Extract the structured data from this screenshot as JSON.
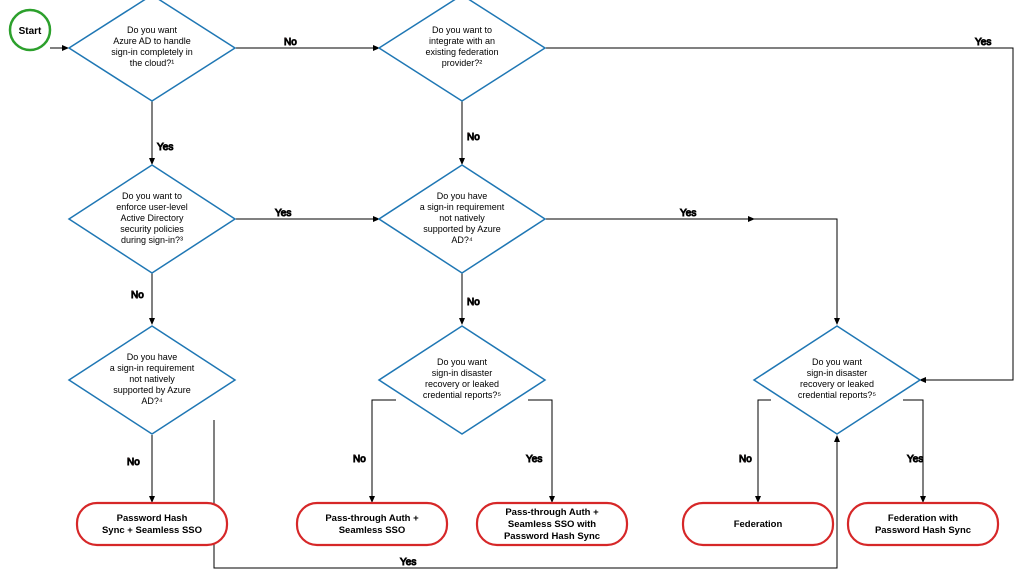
{
  "start": {
    "label": "Start"
  },
  "decisions": {
    "d1": {
      "l1": "Do you want",
      "l2": "Azure AD to handle",
      "l3": "sign-in completely in",
      "l4": "the cloud?¹"
    },
    "d2": {
      "l1": "Do you want to",
      "l2": "integrate with an",
      "l3": "existing federation",
      "l4": "provider?²"
    },
    "d3": {
      "l1": "Do you want to",
      "l2": "enforce user-level",
      "l3": "Active Directory",
      "l4": "security policies",
      "l5": "during sign-in?³"
    },
    "d4": {
      "l1": "Do you have",
      "l2": "a sign-in requirement",
      "l3": "not natively",
      "l4": "supported by Azure",
      "l5": "AD?⁴"
    },
    "d5": {
      "l1": "Do you have",
      "l2": "a sign-in requirement",
      "l3": "not natively",
      "l4": "supported by Azure",
      "l5": "AD?⁴"
    },
    "d6": {
      "l1": "Do you want",
      "l2": "sign-in disaster",
      "l3": "recovery or leaked",
      "l4": "credential reports?⁵"
    },
    "d7": {
      "l1": "Do you want",
      "l2": "sign-in disaster",
      "l3": "recovery or leaked",
      "l4": "credential reports?⁵"
    }
  },
  "terminators": {
    "t1": {
      "l1": "Password Hash",
      "l2": "Sync + Seamless SSO"
    },
    "t2": {
      "l1": "Pass-through Auth +",
      "l2": "Seamless SSO"
    },
    "t3": {
      "l1": "Pass-through Auth +",
      "l2": "Seamless SSO with",
      "l3": "Password Hash Sync"
    },
    "t4": {
      "l1": "Federation"
    },
    "t5": {
      "l1": "Federation with",
      "l2": "Password Hash Sync"
    }
  },
  "labels": {
    "yes": "Yes",
    "no": "No"
  },
  "colors": {
    "decision_stroke": "#1f77b4",
    "terminator_stroke": "#d62728",
    "start_stroke": "#2ca02c",
    "connector": "#000000",
    "yes": "#109618",
    "no": "#d62728"
  }
}
